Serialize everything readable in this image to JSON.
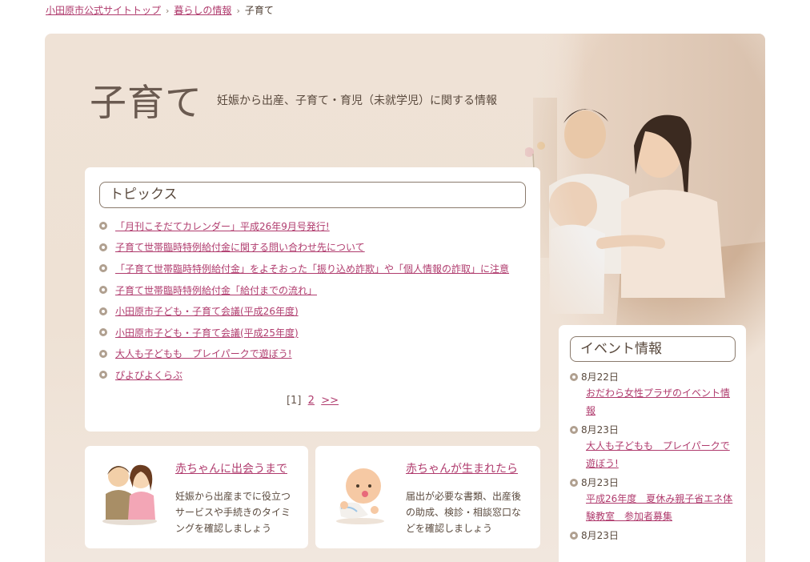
{
  "breadcrumb": {
    "items": [
      "小田原市公式サイトトップ",
      "暮らしの情報"
    ],
    "current": "子育て",
    "separator": "›"
  },
  "page": {
    "title": "子育て",
    "subtitle": "妊娠から出産、子育て・育児（未就学児）に関する情報"
  },
  "topics": {
    "heading": "トピックス",
    "items": [
      "「月刊こそだてカレンダー」平成26年9月号発行!",
      "子育て世帯臨時特例給付金に関する問い合わせ先について",
      "「子育て世帯臨時特例給付金」をよそおった「振り込め詐欺」や「個人情報の詐取」に注意",
      "子育て世帯臨時特例給付金「給付までの流れ」",
      "小田原市子ども・子育て会議(平成26年度)",
      "小田原市子ども・子育て会議(平成25年度)",
      "大人も子どもも　プレイパークで遊ぼう!",
      "ぴよぴよくらぶ"
    ],
    "pager": {
      "current": "[1]",
      "page2": "2",
      "next": ">>"
    }
  },
  "cards": [
    {
      "title": "赤ちゃんに出会うまで",
      "description": "妊娠から出産までに役立つサービスや手続きのタイミングを確認しましょう"
    },
    {
      "title": "赤ちゃんが生まれたら",
      "description": "届出が必要な書類、出産後の助成、検診・相談窓口などを確認しましょう"
    }
  ],
  "events": {
    "heading": "イベント情報",
    "items": [
      {
        "date": "8月22日",
        "title": "おだわら女性プラザのイベント情報"
      },
      {
        "date": "8月23日",
        "title": "大人も子どもも　プレイパークで遊ぼう!"
      },
      {
        "date": "8月23日",
        "title": "平成26年度　夏休み親子省エネ体験教室　参加者募集"
      },
      {
        "date": "8月23日",
        "title": ""
      }
    ]
  },
  "colors": {
    "link": "#b03c6e",
    "text": "#5a4a3e",
    "hero_bg": "#efe2d6"
  }
}
